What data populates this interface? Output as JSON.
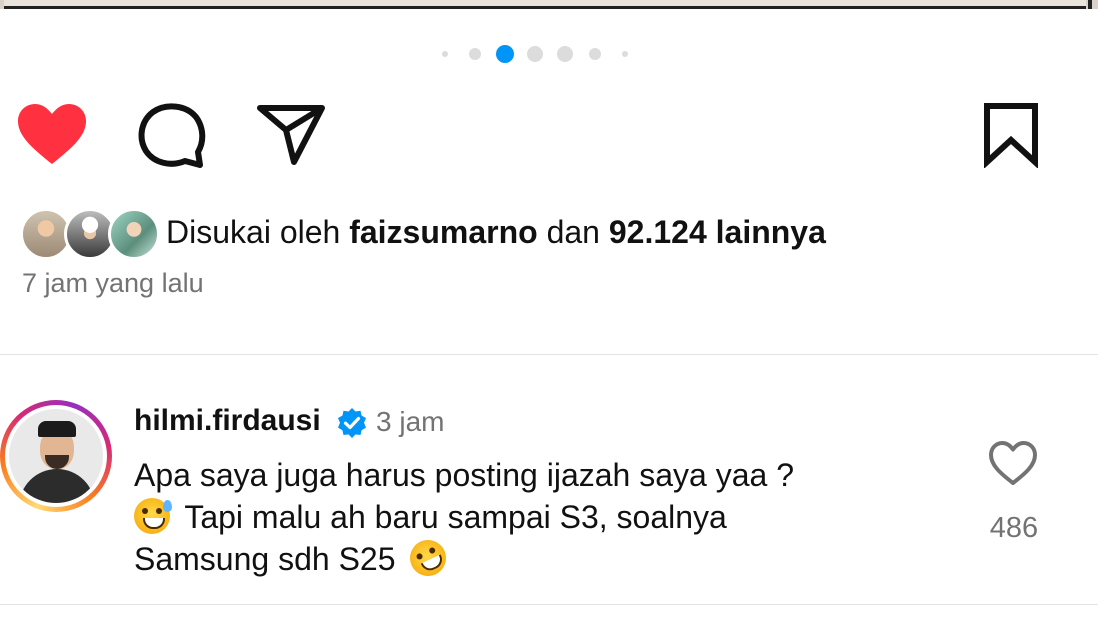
{
  "colors": {
    "like_red": "#ff3040",
    "carousel_active": "#0095f6",
    "carousel_inactive": "#dcdcdc",
    "secondary_text": "#737373",
    "verified_blue": "#0095f6"
  },
  "carousel": {
    "total": 7,
    "active_index": 2
  },
  "actions": {
    "like_icon": "heart-filled-icon",
    "comment_icon": "comment-bubble-icon",
    "share_icon": "paper-plane-icon",
    "save_icon": "bookmark-icon"
  },
  "likes": {
    "prefix": "Disukai oleh ",
    "user": "faizsumarno",
    "middle": " dan ",
    "count": "92.124 lainnya"
  },
  "post_time": "7 jam yang lalu",
  "comment": {
    "username": "hilmi.firdausi",
    "time": "3 jam",
    "lines": [
      "Apa saya juga harus posting ijazah saya yaa ?",
      "Tapi malu ah baru sampai S3, soalnya",
      "Samsung sdh S25"
    ],
    "emoji_1": "grinning-face-with-sweat",
    "emoji_2": "rolling-on-the-floor-laughing",
    "like_count": "486"
  }
}
